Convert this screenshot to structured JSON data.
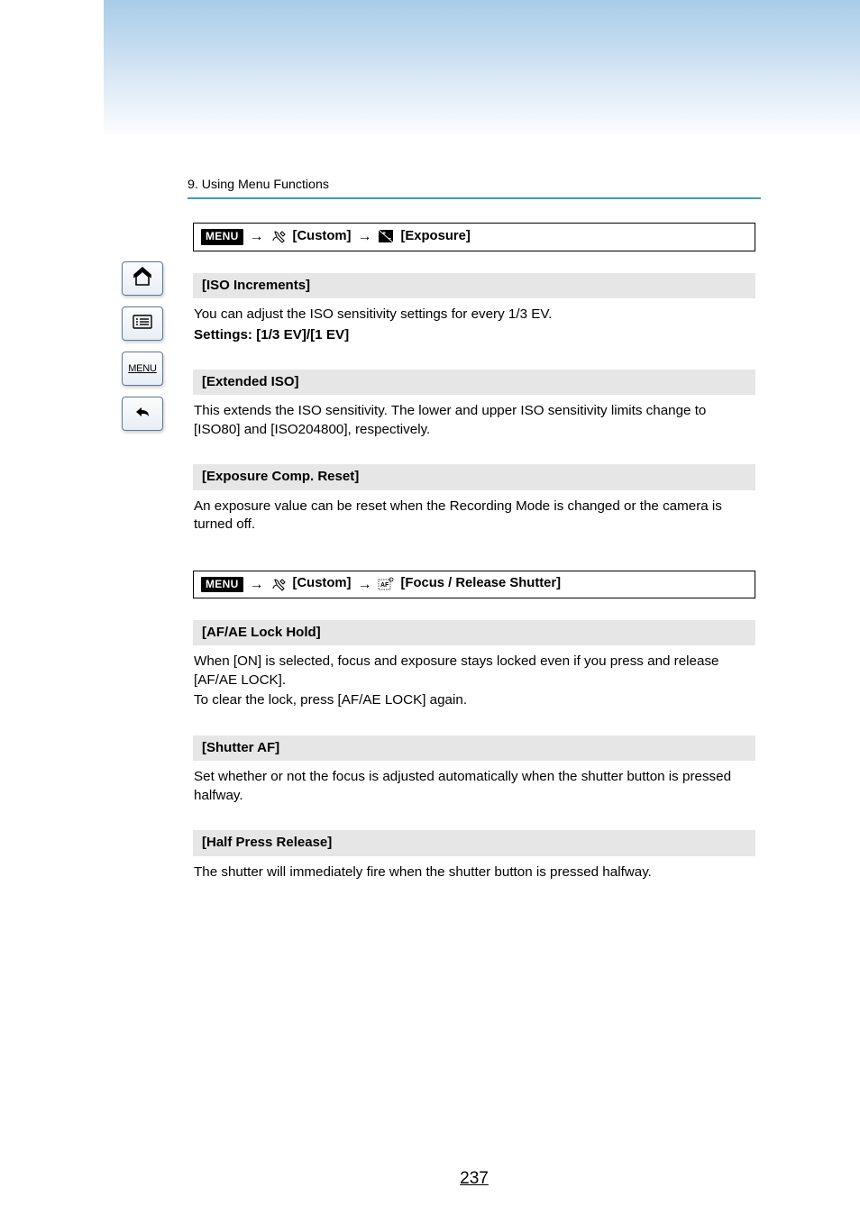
{
  "chapter": "9. Using Menu Functions",
  "breadcrumb1": {
    "custom": "[Custom]",
    "exposure": "[Exposure]"
  },
  "sections": {
    "iso_increments": {
      "title": "[ISO Increments]",
      "body_line1": "You can adjust the ISO sensitivity settings for every 1/3 EV.",
      "settings": "Settings: [1/3 EV]/[1 EV]"
    },
    "extended_iso": {
      "title": "[Extended ISO]",
      "body": "This extends the ISO sensitivity. The lower and upper ISO sensitivity limits change to [ISO80] and [ISO204800], respectively."
    },
    "exposure_comp_reset": {
      "title": "[Exposure Comp. Reset]",
      "body": "An exposure value can be reset when the Recording Mode is changed or the camera is turned off."
    }
  },
  "breadcrumb2": {
    "custom": "[Custom]",
    "focus": "[Focus / Release Shutter]"
  },
  "sections2": {
    "af_ae_lock_hold": {
      "title": "[AF/AE Lock Hold]",
      "body_line1": "When [ON] is selected, focus and exposure stays locked even if you press and release [AF/AE LOCK].",
      "body_line2": "To clear the lock, press [AF/AE LOCK] again."
    },
    "shutter_af": {
      "title": "[Shutter AF]",
      "body": "Set whether or not the focus is adjusted automatically when the shutter button is pressed halfway."
    },
    "half_press_release": {
      "title": "[Half Press Release]",
      "body": "The shutter will immediately fire when the shutter button is pressed halfway."
    }
  },
  "page_number": "237",
  "menu_badge_text": "MENU",
  "sidebar": {
    "menu_text": "MENU"
  }
}
